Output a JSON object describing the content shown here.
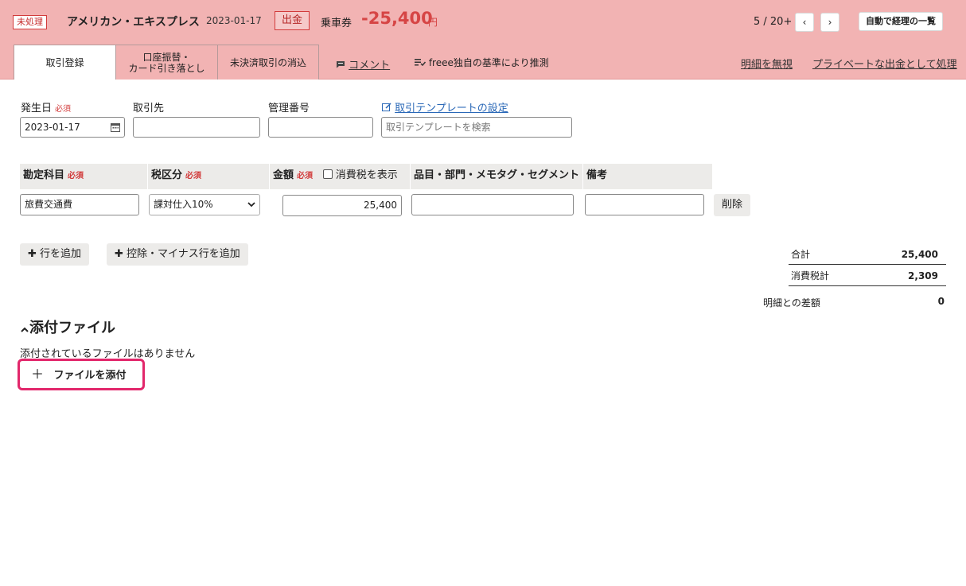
{
  "header": {
    "status_badge": "未処理",
    "title": "アメリカン・エキスプレス",
    "date": "2023-01-17",
    "type_badge": "出金",
    "partner": "乗車券",
    "amount": "-25,400",
    "currency": "円",
    "pager": "5 / 20+",
    "auto_list_label": "自動で経理の一覧"
  },
  "tabs": [
    {
      "label": "取引登録"
    },
    {
      "label1": "口座振替・",
      "label2": "カード引き落とし"
    },
    {
      "label": "未決済取引の消込"
    }
  ],
  "header_links": {
    "comment": "コメント",
    "estimate": "freee独自の基準により推測",
    "ignore": "明細を無視",
    "private": "プライベートな出金として処理"
  },
  "form": {
    "date_label": "発生日",
    "required": "必須",
    "date_value": "2023-01-17",
    "partner_label": "取引先",
    "mgmt_label": "管理番号",
    "template_settings": "取引テンプレートの設定",
    "template_placeholder": "取引テンプレートを検索"
  },
  "table": {
    "headers": {
      "account": "勘定科目",
      "tax": "税区分",
      "amount": "金額",
      "show_tax": "消費税を表示",
      "items": "品目・部門・メモタグ・セグメント",
      "memo": "備考"
    },
    "row": {
      "account": "旅費交通費",
      "tax": "課対仕入10%",
      "amount": "25,400",
      "delete": "削除"
    }
  },
  "actions": {
    "add_row": "行を追加",
    "add_minus_row": "控除・マイナス行を追加"
  },
  "summary": {
    "total_label": "合計",
    "total_value": "25,400",
    "tax_label": "消費税計",
    "tax_value": "2,309",
    "diff_label": "明細との差額",
    "diff_value": "0"
  },
  "attachments": {
    "title": "添付ファイル",
    "empty": "添付されているファイルはありません",
    "attach_button": "ファイルを添付"
  },
  "colors": {
    "header_bg": "#f2b3b3",
    "accent_red": "#d64545",
    "highlight": "#e2276b",
    "link_blue": "#2a68b7"
  }
}
